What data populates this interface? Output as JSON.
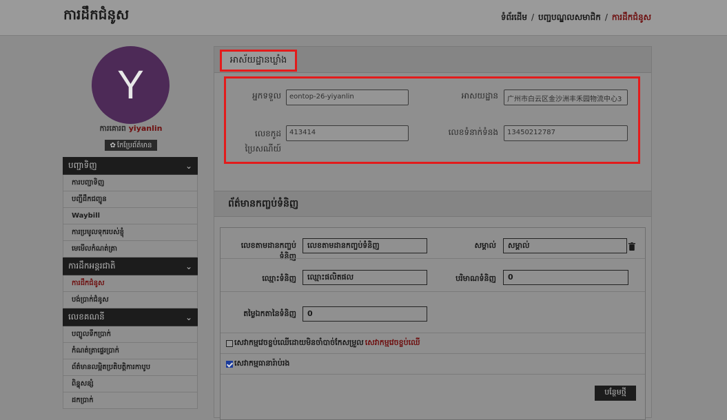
{
  "header": {
    "title": "ការដឹកជំនូស",
    "breadcrumb": [
      "ទំព័រដើម",
      "បញ្ជបណ្ឌលសមាជិក",
      "ការដឹកជំនូស"
    ]
  },
  "profile": {
    "avatar_letter": "Y",
    "prefix": "ការគោរព",
    "username": "yiyanlin",
    "edit_label": "កែប្រែព័ត៌មាន",
    "avatar_color": "#4d2a57"
  },
  "sidebar": [
    {
      "header": "បញ្ជាទិញ",
      "items": [
        "ការបញ្ជាទិញ",
        "បញ្ជីដឹកជញ្ជូន",
        "Waybill",
        "ការប្រមូលទុករបស់ខ្ញុំ",
        "មេមើលកំណត់ត្រា"
      ]
    },
    {
      "header": "ការដឹកអន្តរជាតិ",
      "items": [
        "ការដឹកជំនូស",
        "បង់ប្រាក់ជំនូស"
      ]
    },
    {
      "header": "លេខគណនី",
      "items": [
        "បញ្ចូលទឹកប្រាក់",
        "កំណត់ត្រាផ្ទេរប្រាក់",
        "ព័ត៌មានលម្អិតប្រតិបត្តិការកាបូប",
        "ពិន្ទុសន្សំ",
        "ដកប្រាក់"
      ]
    }
  ],
  "address_section": {
    "title": "អាស័យដ្ឋានឃ្លាំង",
    "fields": {
      "receiver": {
        "label": "អ្នកទទួល",
        "value": "eontop-26-yiyanlin"
      },
      "address": {
        "label": "អាសយដ្ឋាន",
        "value": "广州市白云区金沙洲丰禾园物流中心3"
      },
      "postal": {
        "label_1": "លេខកូដ",
        "label_2": "ប្រៃសណីយ៍",
        "value": "413414"
      },
      "phone": {
        "label": "លេខទំនាក់ទំនង",
        "value": "13450212787"
      }
    }
  },
  "package_section": {
    "title": "ព័ត៌មានកញ្ចប់ទំនិញ",
    "tracking": {
      "label": "លេខតាមដានកញ្ចប់ទំនិញ",
      "placeholder": "លេខតាមដានកញ្ចប់ទំនិញ"
    },
    "note": {
      "label": "សម្គាល់",
      "placeholder": "សម្គាល់"
    },
    "product_name": {
      "label": "ឈ្មោះទំនិញ",
      "placeholder": "ឈ្មោះផលិតផល"
    },
    "quantity": {
      "label": "បរិមាណទំនិញ",
      "value": "0"
    },
    "unit_price": {
      "label": "តម្លៃឯកតានៃទំនិញ",
      "value": "0"
    },
    "wood_check": {
      "label": "សេវាកម្មវេចខ្ចប់ឈើដោយមិនចាំបាច់កែសម្រួល",
      "label_red": "សេវាកម្មវេចខ្ចប់ឈើ",
      "checked": false
    },
    "insurance_check": {
      "label": "សេវាកម្មធានារ៉ាប់រង",
      "checked": true
    },
    "add_button": "បន្ថែមថ្មី"
  }
}
